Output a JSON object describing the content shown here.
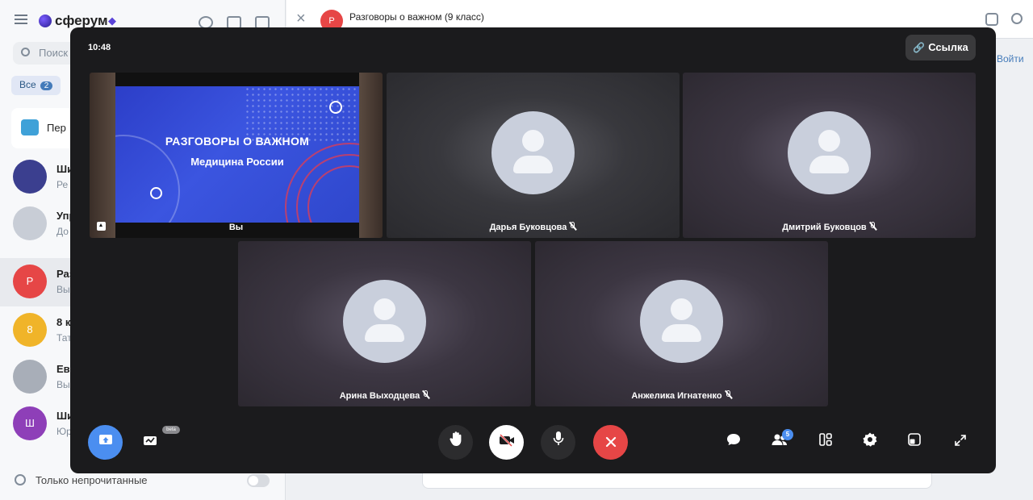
{
  "app": {
    "logo": "сферум",
    "search_placeholder": "Поиск",
    "filter_label": "Все",
    "filter_count": "2",
    "pinned_label": "Пер",
    "chats": [
      {
        "initial": "",
        "name": "Ши",
        "preview": "Ре",
        "color": "#3b3f8f"
      },
      {
        "initial": "",
        "name": "Упр",
        "preview": "До",
        "color": "#c8cdd6"
      },
      {
        "initial": "Р",
        "name": "Раз",
        "preview": "Вы",
        "color": "#e64646"
      },
      {
        "initial": "8",
        "name": "8 к",
        "preview": "Тат",
        "color": "#f0b429"
      },
      {
        "initial": "",
        "name": "Евг",
        "preview": "Вы",
        "color": "#a8aeb8"
      },
      {
        "initial": "Ш",
        "name": "Ши",
        "preview": "Юр",
        "color": "#8e3fb8"
      }
    ],
    "unread_only_label": "Только непрочитанные",
    "chat_avatar_initial": "Р",
    "chat_title": "Разговоры о важном (9 класс)",
    "join_label": "Войти"
  },
  "call": {
    "time": "10:48",
    "link_label": "Ссылка",
    "self": {
      "name": "Вы",
      "slide_title": "РАЗГОВОРЫ О ВАЖНОМ",
      "slide_subtitle": "Медицина России"
    },
    "participants": [
      {
        "name": "Дарья Буковцова"
      },
      {
        "name": "Дмитрий Буковцов"
      },
      {
        "name": "Арина Выходцева"
      },
      {
        "name": "Анжелика Игнатенко"
      }
    ],
    "beta_label": "beta",
    "participants_count": "5",
    "colors": {
      "accent": "#4b8ef0",
      "end_call": "#e64646",
      "modal_bg": "#1b1b1d"
    }
  }
}
